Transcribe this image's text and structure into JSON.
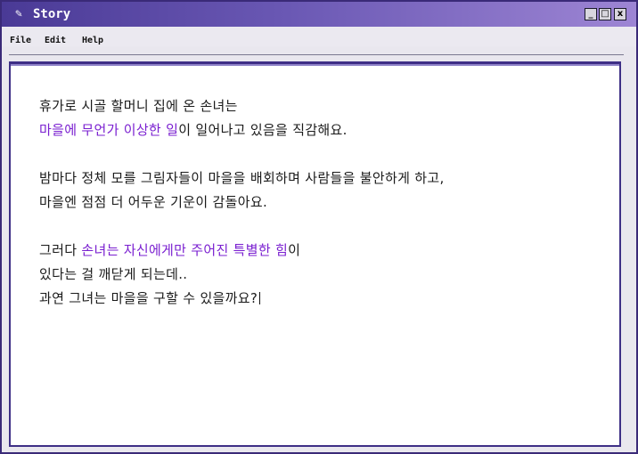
{
  "window": {
    "title": "Story",
    "icon": "book-icon",
    "controls": {
      "minimize": "_",
      "maximize": "□",
      "close": "x"
    }
  },
  "menu": [
    "File",
    "Edit",
    "Help"
  ],
  "story": {
    "p1_l1": "휴가로 시골 할머니 집에 온 손녀는",
    "p1_l2_hl": "마을에 무언가 이상한 일",
    "p1_l2_rest": "이 일어나고 있음을 직감해요.",
    "p2_l1": "밤마다 정체 모를 그림자들이 마을을 배회하며 사람들을 불안하게 하고,",
    "p2_l2": "마을엔 점점 더 어두운 기운이 감돌아요.",
    "p3_l1_pre": "그러다 ",
    "p3_l1_hl": "손녀는 자신에게만 주어진 특별한 힘",
    "p3_l1_post": "이",
    "p3_l2": "있다는 걸 깨닫게 되는데..",
    "p3_l3": "과연 그녀는 마을을 구할 수 있을까요?"
  },
  "colors": {
    "title_gradient_start": "#4a3a96",
    "title_gradient_end": "#9d85d4",
    "highlight": "#7a1fd0",
    "frame_border": "#3e2f86"
  }
}
